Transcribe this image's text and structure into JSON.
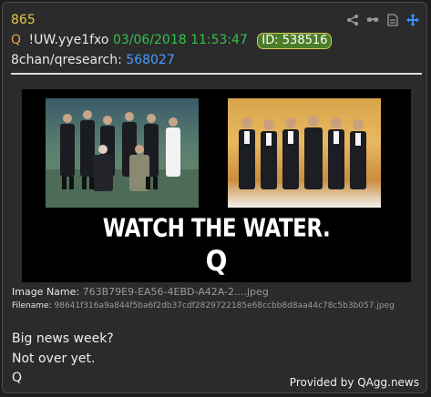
{
  "post": {
    "number": "865",
    "q_mark": "Q",
    "tripcode": "!UW.yye1fxo",
    "datetime": "03/06/2018 11:53:47",
    "id_label": "ID: 538516",
    "board": "8chan/qresearch:",
    "thread_link": "568027"
  },
  "toolbar": {
    "icons": [
      "share-icon",
      "glasses-icon",
      "document-icon",
      "move-icon"
    ]
  },
  "image": {
    "headline": "WATCH THE WATER.",
    "signature": "Q",
    "name_label": "Image Name:",
    "name_value": "763B79E9-EA56-4EBD-A42A-2....jpeg",
    "file_label": "Filename:",
    "file_value": "98641f316a9a844f5ba6f2db37cdf2829722185e68ccbb8d8aa44c78c5b3b057.jpeg"
  },
  "message": {
    "lines": [
      "Big news week?",
      "Not over yet.",
      "Q"
    ]
  },
  "footer": {
    "provided": "Provided by QAgg.news"
  },
  "colors": {
    "post_number": "#e6c84a",
    "date": "#35c04a",
    "link": "#4b9bff",
    "id_badge": "#4c7d28"
  }
}
